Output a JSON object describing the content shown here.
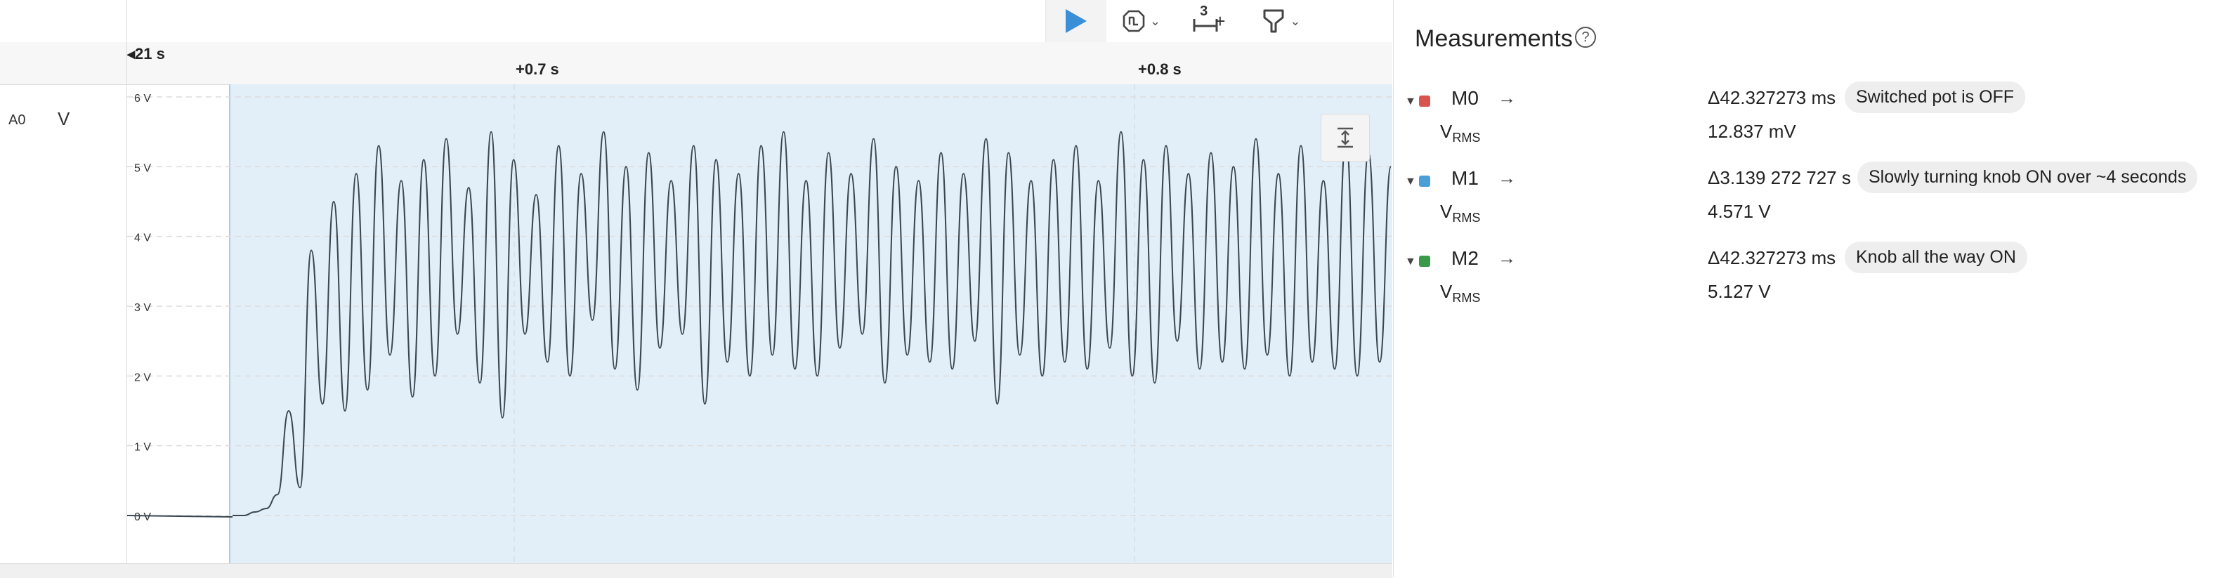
{
  "toolbar": {
    "play_icon": "play-icon",
    "trigger_icon": "trigger-icon",
    "measure_count": "3",
    "measure_plus": "+",
    "marker_icon": "marker-icon"
  },
  "ruler": {
    "left_label": "21 s",
    "ticks": [
      "+0.7 s",
      "+0.8 s"
    ]
  },
  "channel": {
    "name": "A0",
    "unit": "V",
    "y_ticks": [
      "6 V",
      "5 V",
      "4 V",
      "3 V",
      "2 V",
      "1 V",
      "0 V"
    ]
  },
  "measurements": {
    "title": "Measurements",
    "help": "?",
    "items": [
      {
        "name": "M0",
        "color": "#d9534f",
        "quantity": "V",
        "quantity_sub": "RMS",
        "delta": "Δ42.327273 ms",
        "note": "Switched pot is OFF",
        "value": "12.837 mV"
      },
      {
        "name": "M1",
        "color": "#4a9fd8",
        "quantity": "V",
        "quantity_sub": "RMS",
        "delta": "Δ3.139 272 727 s",
        "note": "Slowly turning knob ON over ~4 seconds",
        "value": "4.571 V"
      },
      {
        "name": "M2",
        "color": "#3a9a4a",
        "quantity": "V",
        "quantity_sub": "RMS",
        "delta": "Δ42.327273 ms",
        "note": "Knob all the way ON",
        "value": "5.127 V"
      }
    ]
  },
  "colors": {
    "selection_fill": "#e3eff8",
    "trace": "#3b4650",
    "play": "#3a8fd6"
  },
  "chart_data": {
    "type": "line",
    "title": "",
    "xlabel": "",
    "ylabel": "V",
    "ylim": [
      0,
      6
    ],
    "x_ticks": [
      "+0.7 s",
      "+0.8 s"
    ],
    "series": [
      {
        "values": [
          0.0,
          0.0,
          0.05,
          0.1,
          0.3,
          1.5,
          0.4,
          3.8,
          1.6,
          4.5,
          1.5,
          4.9,
          1.8,
          5.3,
          2.3,
          4.8,
          1.7,
          5.1,
          2.0,
          5.4,
          2.6,
          4.7,
          1.9,
          5.5,
          1.4,
          5.1,
          2.6,
          4.6,
          2.2,
          5.3,
          2.0,
          4.9,
          2.8,
          5.5,
          2.1,
          5.0,
          1.8,
          5.2,
          2.4,
          4.8,
          2.6,
          5.3,
          1.6,
          5.1,
          2.2,
          4.9,
          2.0,
          5.3,
          2.3,
          5.5,
          2.1,
          4.8,
          2.0,
          5.2,
          2.4,
          4.9,
          2.6,
          5.4,
          1.9,
          5.0,
          2.3,
          4.8,
          2.2,
          5.2,
          2.1,
          4.9,
          2.5,
          5.4,
          1.6,
          5.2,
          2.3,
          4.8,
          2.0,
          5.1,
          2.2,
          5.3,
          2.1,
          4.8,
          2.4,
          5.5,
          2.0,
          5.1,
          1.9,
          5.3,
          2.5,
          4.9,
          2.1,
          5.2,
          2.2,
          5.0,
          2.1,
          5.4,
          2.3,
          4.9,
          2.0,
          5.3,
          2.2,
          4.8,
          2.1,
          5.4,
          2.0,
          5.2,
          2.2,
          5.0
        ]
      }
    ]
  }
}
